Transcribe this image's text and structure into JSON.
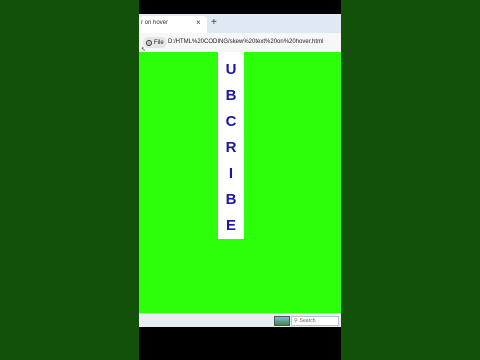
{
  "browser": {
    "tab_title": "r on hover",
    "tab_close": "×",
    "new_tab": "+",
    "file_label": "File",
    "url": "D:/HTML%20CODING/skew%20text%20on%20hover.html"
  },
  "page": {
    "letters": [
      "U",
      "B",
      "C",
      "R",
      "I",
      "B",
      "E"
    ]
  },
  "taskbar": {
    "search_placeholder": "Search"
  },
  "colors": {
    "background": "#2dff0a",
    "letter": "#1c17a3",
    "side_panels": "#11510a"
  }
}
